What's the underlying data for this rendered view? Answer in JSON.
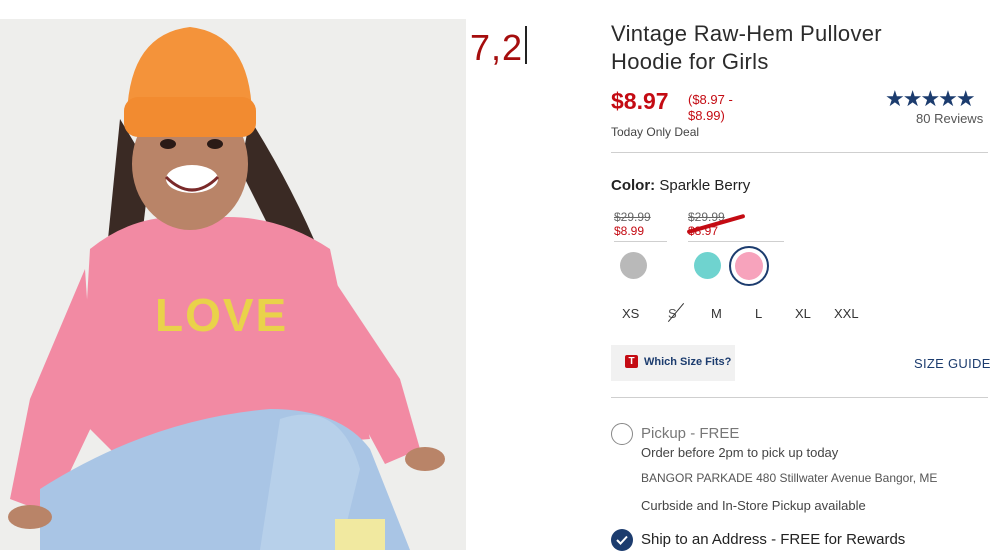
{
  "annotation": {
    "text": "7,2"
  },
  "product": {
    "title": "Vintage Raw-Hem Pullover Hoodie for Girls",
    "price": "$8.97",
    "price_range_line1": "($8.97 -",
    "price_range_line2": "$8.99)",
    "deal": "Today Only Deal",
    "rating": 4.5,
    "stars": "★★★★★",
    "reviews": "80 Reviews"
  },
  "color": {
    "label": "Color:",
    "value": "Sparkle Berry",
    "groups": [
      {
        "was": "$29.99",
        "now": "$8.99"
      },
      {
        "was": "$29.99",
        "now": "$8.97"
      }
    ],
    "swatches": [
      {
        "name": "grey",
        "hex": "#b9b9b9",
        "selected": false
      },
      {
        "name": "aqua",
        "hex": "#6fd3cf",
        "selected": false
      },
      {
        "name": "pink",
        "hex": "#f7a3bc",
        "selected": true
      }
    ]
  },
  "sizes": [
    "XS",
    "S",
    "M",
    "L",
    "XL",
    "XXL"
  ],
  "size_help": {
    "badge": "T",
    "label": "Which Size Fits?",
    "guide": "SIZE GUIDE"
  },
  "fulfillment": {
    "pickup_title": "Pickup - FREE",
    "pickup_sub": "Order before 2pm to pick up today",
    "store": "BANGOR PARKADE 480 Stillwater Avenue  Bangor, ME",
    "curbside": "Curbside and In-Store Pickup available",
    "ship": "Ship to an Address - FREE for Rewards"
  },
  "colors": {
    "accent": "#c40b13",
    "navy": "#1c3c6e"
  }
}
